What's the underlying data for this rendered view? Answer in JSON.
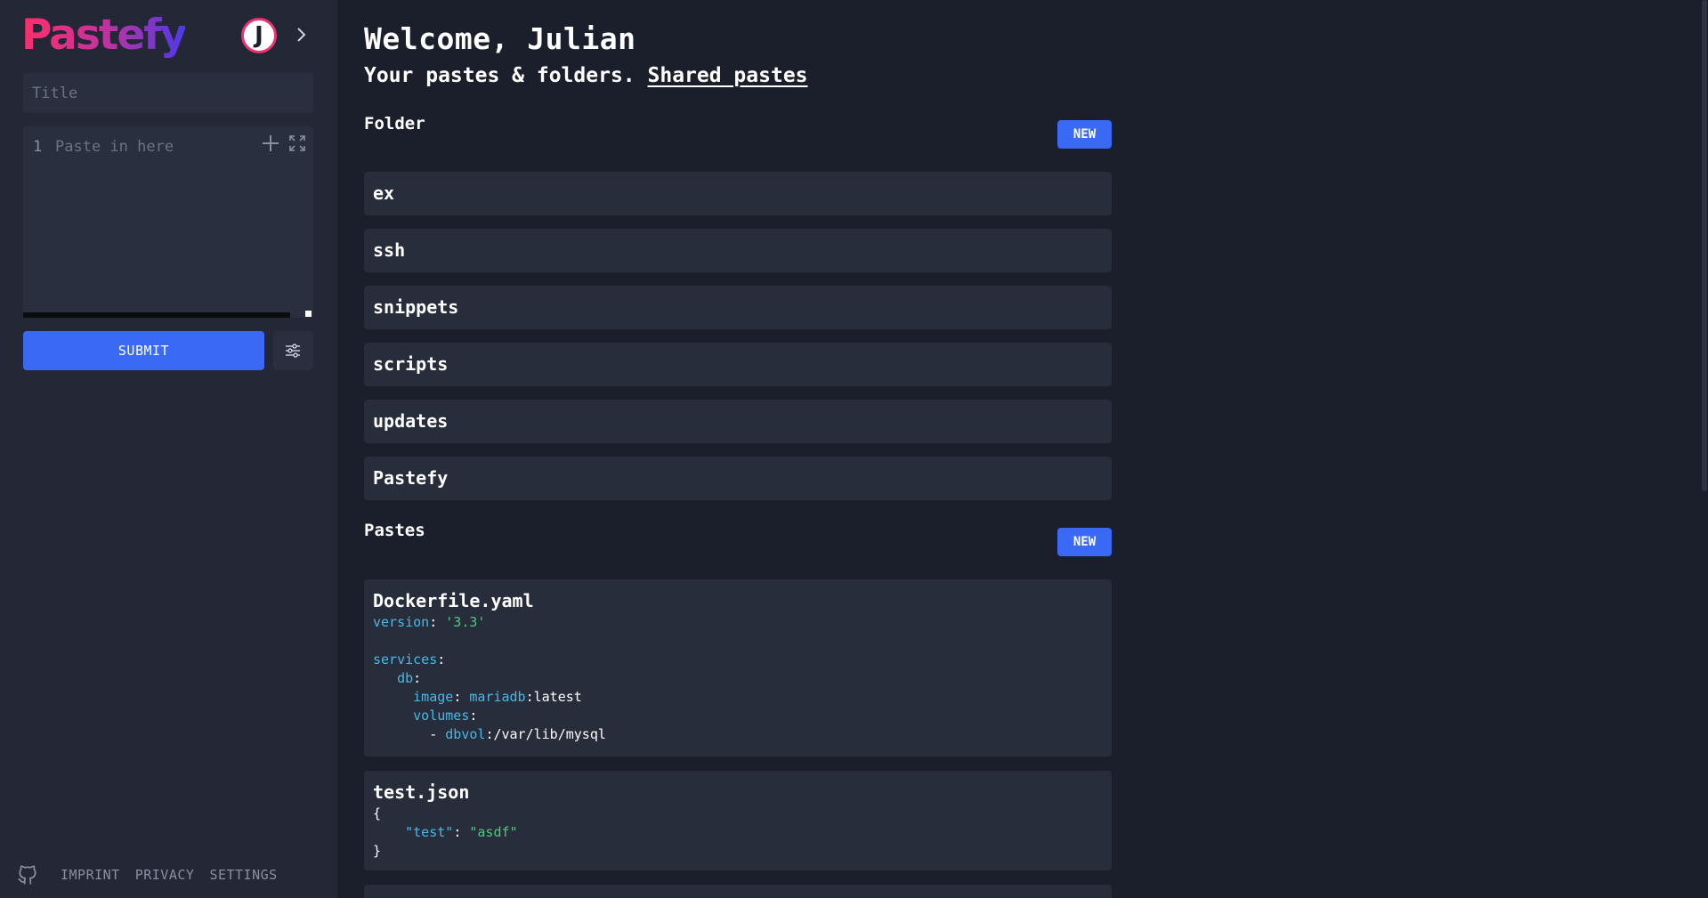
{
  "sidebar": {
    "logo": "Pastefy",
    "avatar_letter": "J",
    "title_placeholder": "Title",
    "editor": {
      "line_number": "1",
      "placeholder": "Paste in here"
    },
    "submit_label": "SUBMIT",
    "footer": {
      "links": [
        "IMPRINT",
        "PRIVACY",
        "SETTINGS"
      ]
    }
  },
  "main": {
    "welcome": "Welcome, Julian",
    "subline": "Your pastes & folders.",
    "shared_link": "Shared pastes",
    "folders_title": "Folder",
    "new_label": "NEW",
    "folders": [
      "ex",
      "ssh",
      "snippets",
      "scripts",
      "updates",
      "Pastefy"
    ],
    "pastes_title": "Pastes",
    "pastes": [
      {
        "title": "Dockerfile.yaml"
      },
      {
        "title": "test.json"
      }
    ]
  },
  "colors": {
    "accent": "#3a6af5",
    "background": "#1b1f2b",
    "sidebar": "#232736",
    "card": "#282d3c",
    "key": "#49b8e4",
    "string": "#4fc97b"
  }
}
